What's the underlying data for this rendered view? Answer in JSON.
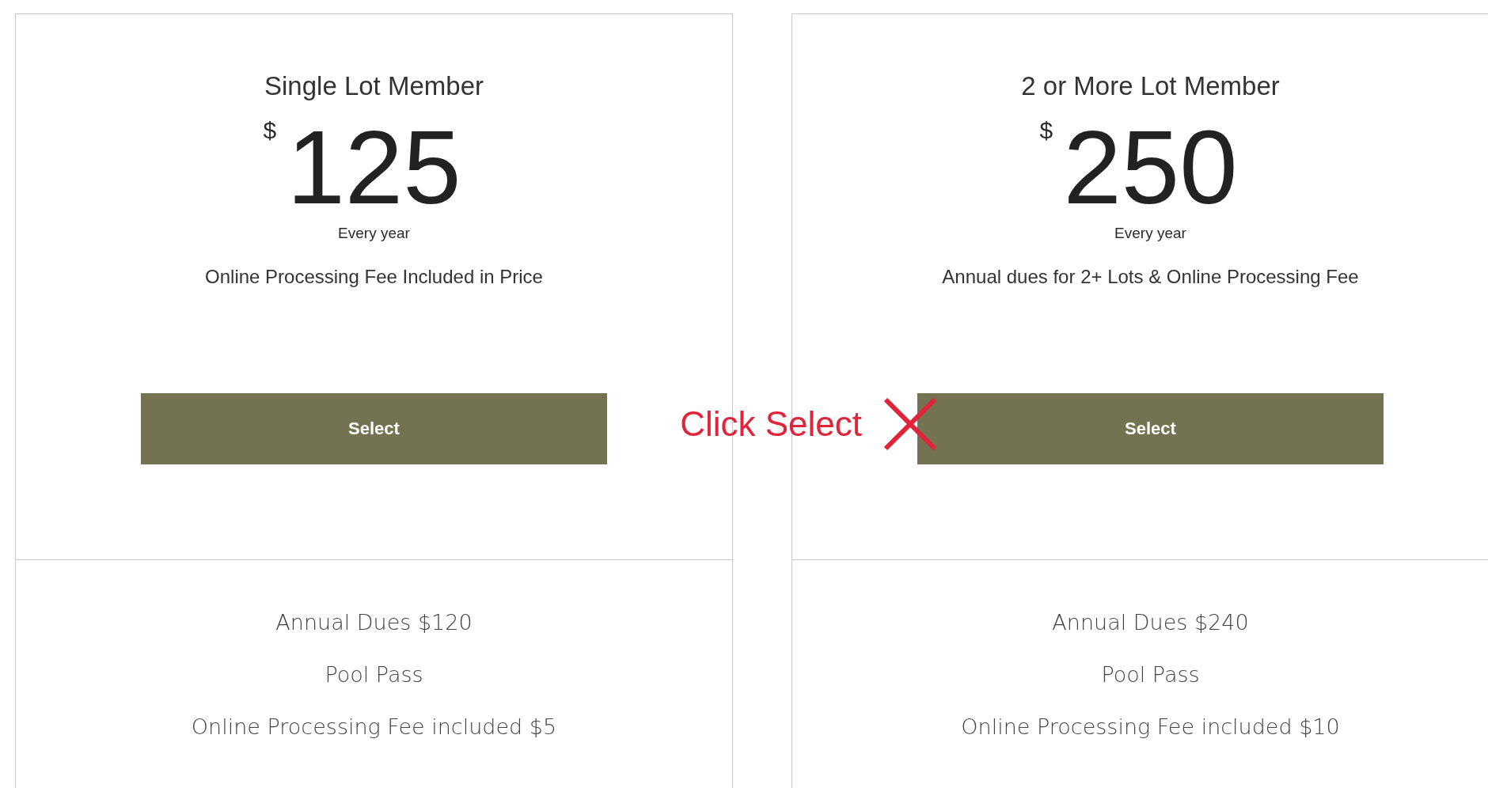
{
  "plans": [
    {
      "title": "Single Lot Member",
      "currency": "$",
      "price": "125",
      "period": "Every year",
      "description": "Online Processing Fee Included in Price",
      "button": "Select",
      "features": [
        "Annual Dues $120",
        "Pool Pass",
        "Online Processing Fee included $5"
      ]
    },
    {
      "title": "2 or More Lot Member",
      "currency": "$",
      "price": "250",
      "period": "Every year",
      "description": "Annual dues for 2+ Lots & Online Processing Fee",
      "button": "Select",
      "features": [
        "Annual Dues $240",
        "Pool Pass",
        "Online Processing Fee included $10"
      ]
    }
  ],
  "annotation": {
    "text": "Click Select"
  }
}
